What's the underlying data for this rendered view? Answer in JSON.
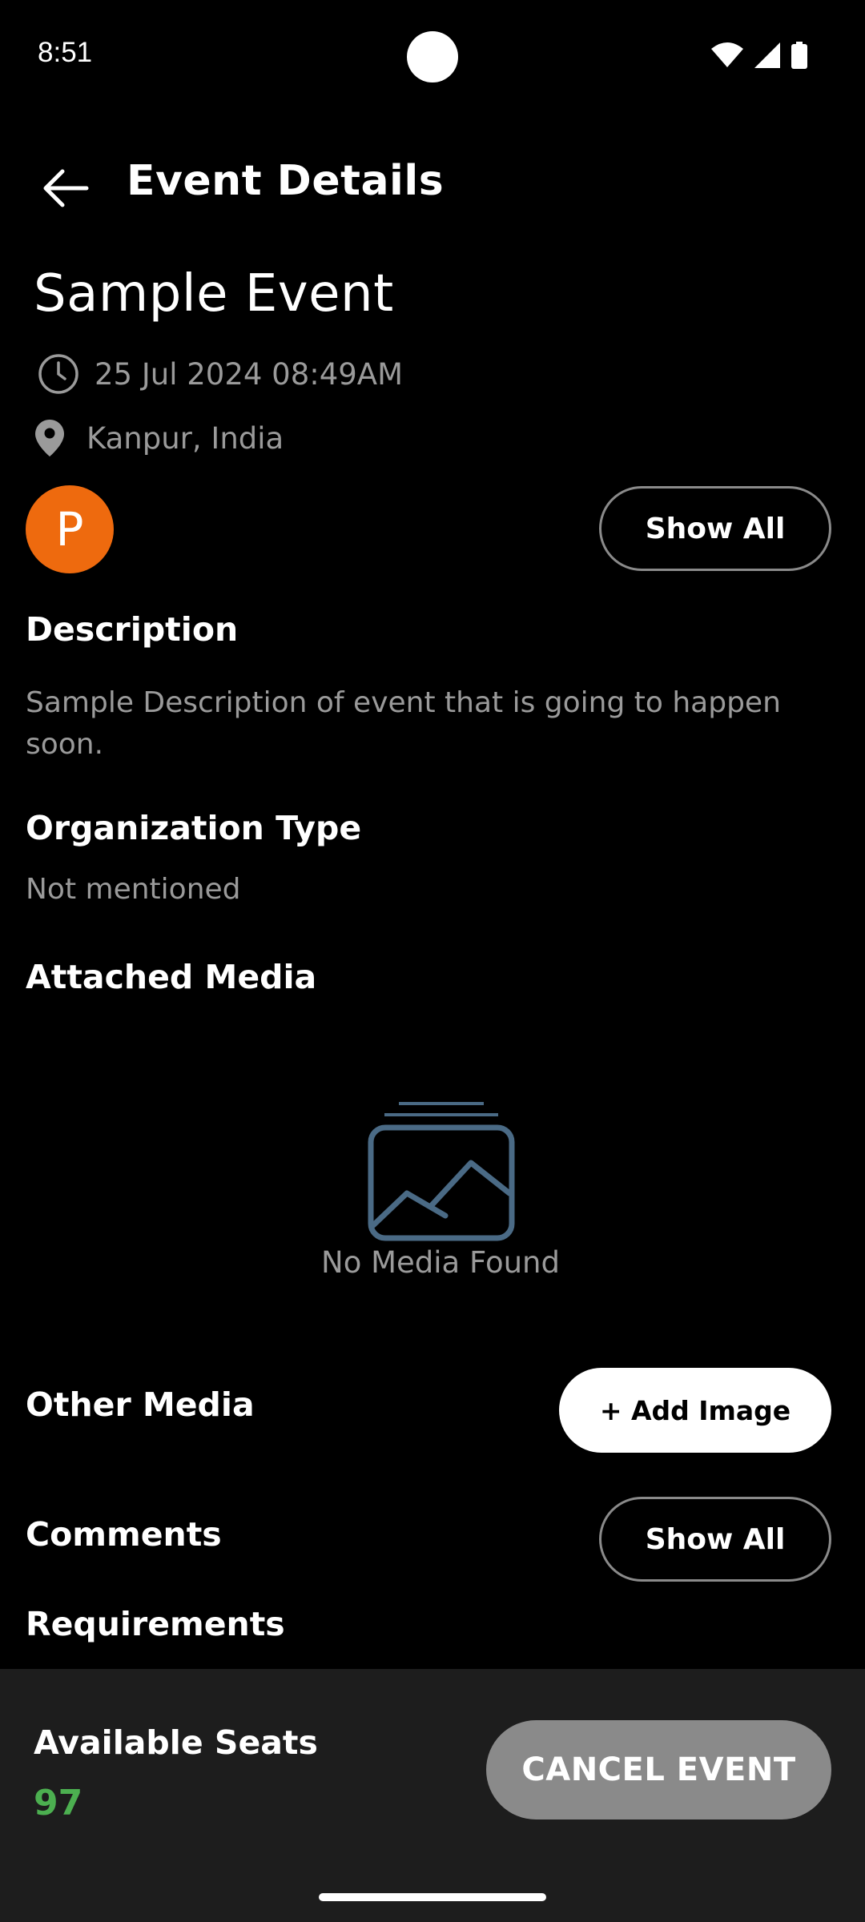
{
  "status_bar": {
    "time": "8:51"
  },
  "app_bar": {
    "title": "Event Details"
  },
  "event": {
    "title": "Sample Event",
    "datetime": "25 Jul 2024 08:49AM",
    "location": "Kanpur, India",
    "avatar_letter": "P"
  },
  "buttons": {
    "show_all_participants": "Show All",
    "add_image": "+ Add Image",
    "show_all_comments": "Show All",
    "cancel_event": "CANCEL EVENT"
  },
  "sections": {
    "description": {
      "heading": "Description",
      "text": "Sample Description of event that is going to happen soon."
    },
    "organization_type": {
      "heading": "Organization Type",
      "value": "Not mentioned"
    },
    "attached_media": {
      "heading": "Attached Media",
      "empty_text": "No Media Found"
    },
    "other_media": {
      "heading": "Other Media"
    },
    "comments": {
      "heading": "Comments"
    },
    "requirements": {
      "heading": "Requirements"
    }
  },
  "bottom_bar": {
    "seats_label": "Available Seats",
    "seats_value": "97"
  },
  "colors": {
    "avatar": "#EE6A0E",
    "seats": "#4CAF50",
    "media_icon": "#4A6A85"
  },
  "icons": [
    "back-arrow-icon",
    "clock-icon",
    "location-pin-icon",
    "image-placeholder-icon",
    "wifi-icon",
    "signal-icon",
    "battery-icon"
  ]
}
